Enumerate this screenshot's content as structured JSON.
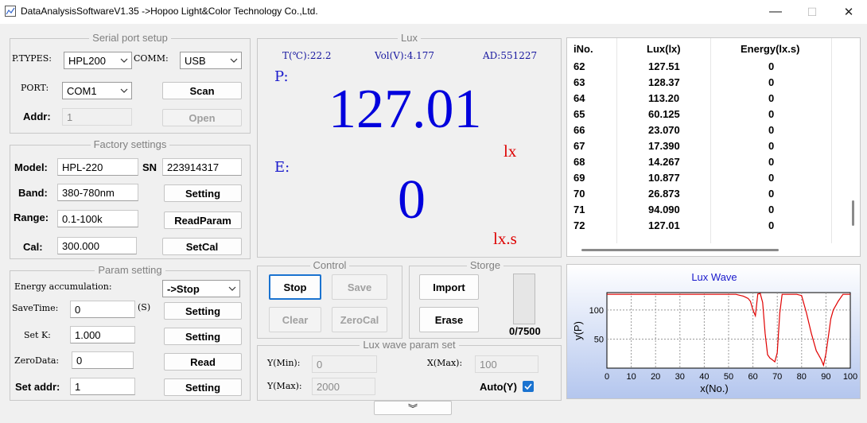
{
  "window": {
    "title": "DataAnalysisSoftwareV1.35 ->Hopoo Light&Color Technology Co.,Ltd.",
    "minimize": "—",
    "maximize": "☐",
    "close": "✕"
  },
  "serial": {
    "title": "Serial port setup",
    "ptypes_label": "P.TYPES:",
    "ptypes_value": "HPL200",
    "comm_label": "COMM:",
    "comm_value": "USB",
    "port_label": "PORT:",
    "port_value": "COM1",
    "scan": "Scan",
    "addr_label": "Addr:",
    "addr_value": "1",
    "open": "Open"
  },
  "factory": {
    "title": "Factory settings",
    "model_label": "Model:",
    "model_value": "HPL-220",
    "sn_label": "SN",
    "sn_value": "223914317",
    "band_label": "Band:",
    "band_value": "380-780nm",
    "band_button": "Setting",
    "range_label": "Range:",
    "range_value": "0.1-100k",
    "range_button": "ReadParam",
    "cal_label": "Cal:",
    "cal_value": "300.000",
    "cal_button": "SetCal"
  },
  "param": {
    "title": "Param setting",
    "energy_label": "Energy accumulation:",
    "energy_value": "->Stop",
    "savetime_label": "SaveTime:",
    "savetime_value": "0",
    "savetime_unit": "(S)",
    "savetime_button": "Setting",
    "setk_label": "Set K:",
    "setk_value": "1.000",
    "setk_button": "Setting",
    "zero_label": "ZeroData:",
    "zero_value": "0",
    "zero_button": "Read",
    "setaddr_label": "Set addr:",
    "setaddr_value": "1",
    "setaddr_button": "Setting"
  },
  "lux": {
    "title": "Lux",
    "temp": "T(℃):22.2",
    "vol": "Vol(V):4.177",
    "ad": "AD:551227",
    "p_label": "P:",
    "p_value": "127.01",
    "p_unit": "lx",
    "e_label": "E:",
    "e_value": "0",
    "e_unit": "lx.s"
  },
  "control": {
    "title": "Control",
    "stop": "Stop",
    "save": "Save",
    "clear": "Clear",
    "zerocal": "ZeroCal"
  },
  "storge": {
    "title": "Storge",
    "import": "Import",
    "erase": "Erase",
    "count": "0/7500",
    "fill_fraction": 0
  },
  "wave_param": {
    "title": "Lux wave param set",
    "ymin_label": "Y(Min):",
    "ymin_value": "0",
    "xmax_label": "X(Max):",
    "xmax_value": "100",
    "ymax_label": "Y(Max):",
    "ymax_value": "2000",
    "auto_label": "Auto(Y)",
    "auto_checked": true
  },
  "table": {
    "headers": [
      "iNo.",
      "Lux(lx)",
      "Energy(lx.s)"
    ],
    "rows": [
      [
        "62",
        "127.51",
        "0"
      ],
      [
        "63",
        "128.37",
        "0"
      ],
      [
        "64",
        "113.20",
        "0"
      ],
      [
        "65",
        "60.125",
        "0"
      ],
      [
        "66",
        "23.070",
        "0"
      ],
      [
        "67",
        "17.390",
        "0"
      ],
      [
        "68",
        "14.267",
        "0"
      ],
      [
        "69",
        "10.877",
        "0"
      ],
      [
        "70",
        "26.873",
        "0"
      ],
      [
        "71",
        "94.090",
        "0"
      ],
      [
        "72",
        "127.01",
        "0"
      ]
    ]
  },
  "chart_data": {
    "type": "line",
    "title": "Lux Wave",
    "xlabel": "x(No.)",
    "ylabel": "y(P)",
    "xlim": [
      0,
      100
    ],
    "ylim": [
      0,
      130
    ],
    "xticks": [
      0,
      10,
      20,
      30,
      40,
      50,
      60,
      70,
      80,
      90,
      100
    ],
    "yticks": [
      50,
      100
    ],
    "grid": true,
    "line_color": "#e00000",
    "x": [
      0,
      50,
      53,
      54,
      55,
      56,
      57,
      58,
      59,
      60,
      61,
      62,
      63,
      64,
      65,
      66,
      67,
      68,
      69,
      70,
      71,
      72,
      78,
      80,
      82,
      84,
      86,
      88,
      89,
      90,
      91,
      92,
      93,
      95,
      97,
      100
    ],
    "y": [
      127,
      127,
      127,
      126,
      125,
      124,
      122,
      120,
      115,
      100,
      90,
      127.51,
      128.37,
      113.2,
      60.125,
      23.07,
      17.39,
      14.267,
      10.877,
      26.873,
      94.09,
      127.01,
      127,
      125,
      95,
      60,
      30,
      15,
      5,
      25,
      55,
      85,
      100,
      115,
      127,
      127
    ]
  },
  "collapse_glyph": "︾"
}
